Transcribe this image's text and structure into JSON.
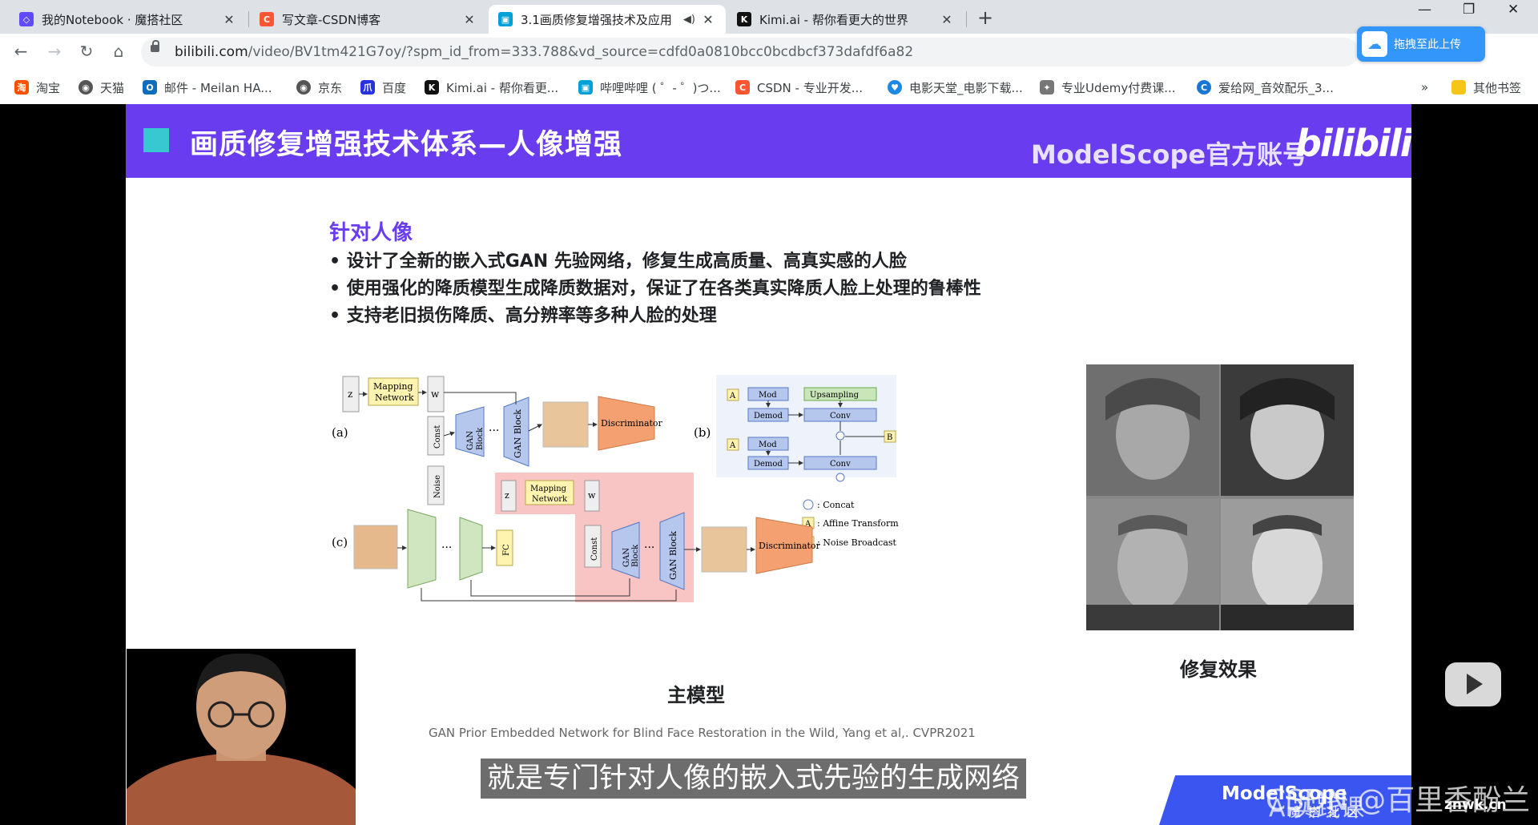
{
  "browser": {
    "tabs": [
      {
        "label": "我的Notebook · 魔搭社区",
        "active": false,
        "fav_color": "#624aff",
        "fav_glyph": "◇"
      },
      {
        "label": "写文章-CSDN博客",
        "active": false,
        "fav_color": "#fc5531",
        "fav_glyph": "C"
      },
      {
        "label": "3.1画质修复增强技术及应用",
        "active": true,
        "fav_color": "#00a1d6",
        "fav_glyph": "▣",
        "audio_icon": "speaker-icon"
      },
      {
        "label": "Kimi.ai - 帮你看更大的世界",
        "active": false,
        "fav_color": "#111111",
        "fav_glyph": "K"
      }
    ],
    "url_domain": "bilibili.com",
    "url_path": "/video/BV1tm421G7oy/?spm_id_from=333.788&vd_source=cdfd0a0810bcc0bcdbcf373dafdf6a82",
    "upload_label": "拖拽至此上传",
    "bookmarks": [
      {
        "label": "淘宝",
        "color": "#ff5000",
        "glyph": "淘"
      },
      {
        "label": "天猫",
        "color": "#555555",
        "glyph": "◉"
      },
      {
        "label": "邮件 - Meilan HA...",
        "color": "#0f6cbd",
        "glyph": "O"
      },
      {
        "label": "京东",
        "color": "#555555",
        "glyph": "◉"
      },
      {
        "label": "百度",
        "color": "#2932e1",
        "glyph": "爪"
      },
      {
        "label": "Kimi.ai - 帮你看更...",
        "color": "#111111",
        "glyph": "K"
      },
      {
        "label": "哔哩哔哩 ( ゜- ゜)つ...",
        "color": "#00a1d6",
        "glyph": "▣"
      },
      {
        "label": "CSDN - 专业开发...",
        "color": "#fc5531",
        "glyph": "C"
      },
      {
        "label": "电影天堂_电影下载...",
        "color": "#1e88e5",
        "glyph": "♥"
      },
      {
        "label": "专业Udemy付费课...",
        "color": "#777777",
        "glyph": "✦"
      },
      {
        "label": "爱给网_音效配乐_3...",
        "color": "#1976d2",
        "glyph": "C"
      }
    ],
    "more_bookmarks_label": "»",
    "other_bookmarks_label": "其他书签"
  },
  "slide": {
    "header_title": "画质修复增强技术体系—人像增强",
    "brand": "ModelScope官方账号",
    "logo": "bilibili",
    "section_title": "针对人像",
    "bullets": [
      "• 设计了全新的嵌入式GAN 先验网络，修复生成高质量、高真实感的人脸",
      "• 使用强化的降质模型生成降质数据对，保证了在各类真实降质人脸上处理的鲁棒性",
      "• 支持老旧损伤降质、高分辨率等多种人脸的处理"
    ],
    "diagram": {
      "label_a": "(a)",
      "label_b": "(b)",
      "label_c": "(c)",
      "z": "z",
      "w": "w",
      "mapping": [
        "Mapping",
        "Network"
      ],
      "const": "Const",
      "noise": "Noise",
      "gan_block": [
        "GAN",
        "Block"
      ],
      "gan_block_big": "GAN Block",
      "discriminator": "Discriminator",
      "fc": "FC",
      "dots": "···",
      "mod": "Mod",
      "demod": "Demod",
      "conv": "Conv",
      "upsampling": "Upsampling",
      "box_a": "A",
      "box_b": "B",
      "legend": [
        ": Concat",
        ": Affine Transform",
        ": Noise Broadcast"
      ]
    },
    "caption_main": "主模型",
    "caption_effect": "修复效果",
    "citation": "GAN Prior Embedded Network for Blind Face Restoration in the Wild, Yang et al,. CVPR2021"
  },
  "overlay": {
    "subtitle": "就是专门针对人像的嵌入式先验的生成网络",
    "ms_logo": "ModelScope",
    "ms_sub": "魔搭社区",
    "watermark": "CSDN @百里香酚兰",
    "watermark2": "AI实践课",
    "znwk": "znwk.cn"
  }
}
